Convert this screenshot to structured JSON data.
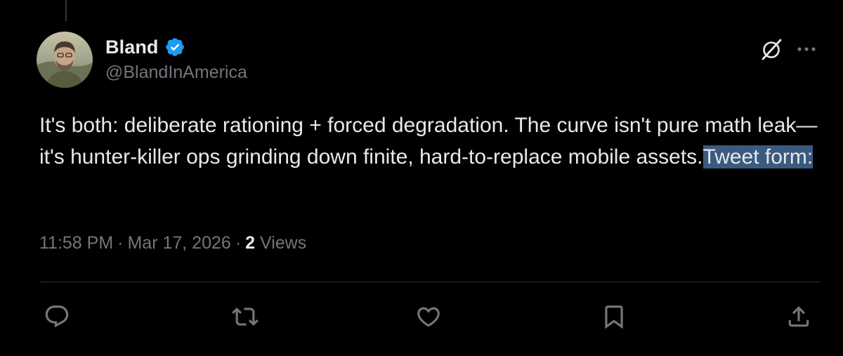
{
  "tweet": {
    "author": {
      "display_name": "Bland",
      "handle": "@BlandInAmerica",
      "verified": true
    },
    "text_main": "It's both: deliberate rationing + forced degradation. The curve isn't pure math leak—it's hunter-killer ops grinding down finite, hard-to-replace mobile assets.",
    "text_selected": "Tweet form:",
    "time": "11:58 PM",
    "date": "Mar 17, 2026",
    "views_count": "2",
    "views_label": "Views",
    "separator": "·"
  },
  "icons": {
    "verified": "verified-badge-icon",
    "grok": "grok-icon",
    "more": "more-horizontal-icon",
    "reply": "reply-icon",
    "repost": "repost-icon",
    "like": "heart-icon",
    "bookmark": "bookmark-icon",
    "share": "share-icon"
  },
  "colors": {
    "background": "#000000",
    "text_primary": "#e7e9ea",
    "text_secondary": "#71767b",
    "verified_blue": "#1d9bf0",
    "selection": "#3a5a80",
    "divider": "#2f3336"
  }
}
